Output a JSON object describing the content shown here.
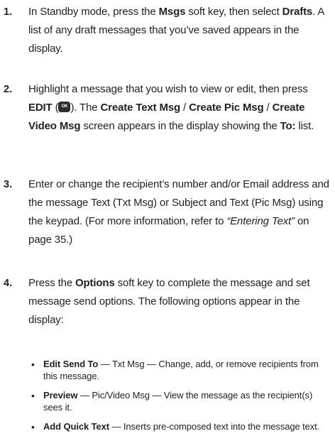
{
  "steps": [
    {
      "number": "1.",
      "parts": {
        "a": "In Standby mode, press the ",
        "b": "Msgs",
        "c": " soft key, then select ",
        "d": "Drafts",
        "e": ". A list of any draft messages that you’ve saved appears in the display."
      }
    },
    {
      "number": "2.",
      "parts": {
        "a": "Highlight a message that you wish to view or edit, then press ",
        "b": "EDIT",
        "c": " (",
        "ok": "OK",
        "d": "). The ",
        "e": "Create Text Msg",
        "f": " / ",
        "g": "Create Pic Msg",
        "h": " / ",
        "i": "Create Video Msg",
        "j": " screen appears in the display showing the ",
        "k": "To:",
        "l": " list."
      }
    },
    {
      "number": "3.",
      "parts": {
        "a": "Enter or change the recipient’s number and/or Email address and the message Text (Txt Msg) or Subject and Text (Pic Msg) using the keypad. (For more information, refer to ",
        "b": "“Entering Text”",
        "c": "  on page 35.)"
      }
    },
    {
      "number": "4.",
      "parts": {
        "a": "Press the ",
        "b": "Options",
        "c": " soft key to complete the message and set message send options. The following options appear in the display:"
      }
    }
  ],
  "options": [
    {
      "bullet": "•",
      "name": "Edit Send To",
      "desc": " — Txt Msg — Change, add, or remove recipients from this message."
    },
    {
      "bullet": "•",
      "name": "Preview",
      "desc": " — Pic/Video Msg — View the message as the recipient(s) sees it."
    },
    {
      "bullet": "•",
      "name": "Add Quick Text",
      "desc": " — Inserts pre-composed text into the message text."
    }
  ]
}
